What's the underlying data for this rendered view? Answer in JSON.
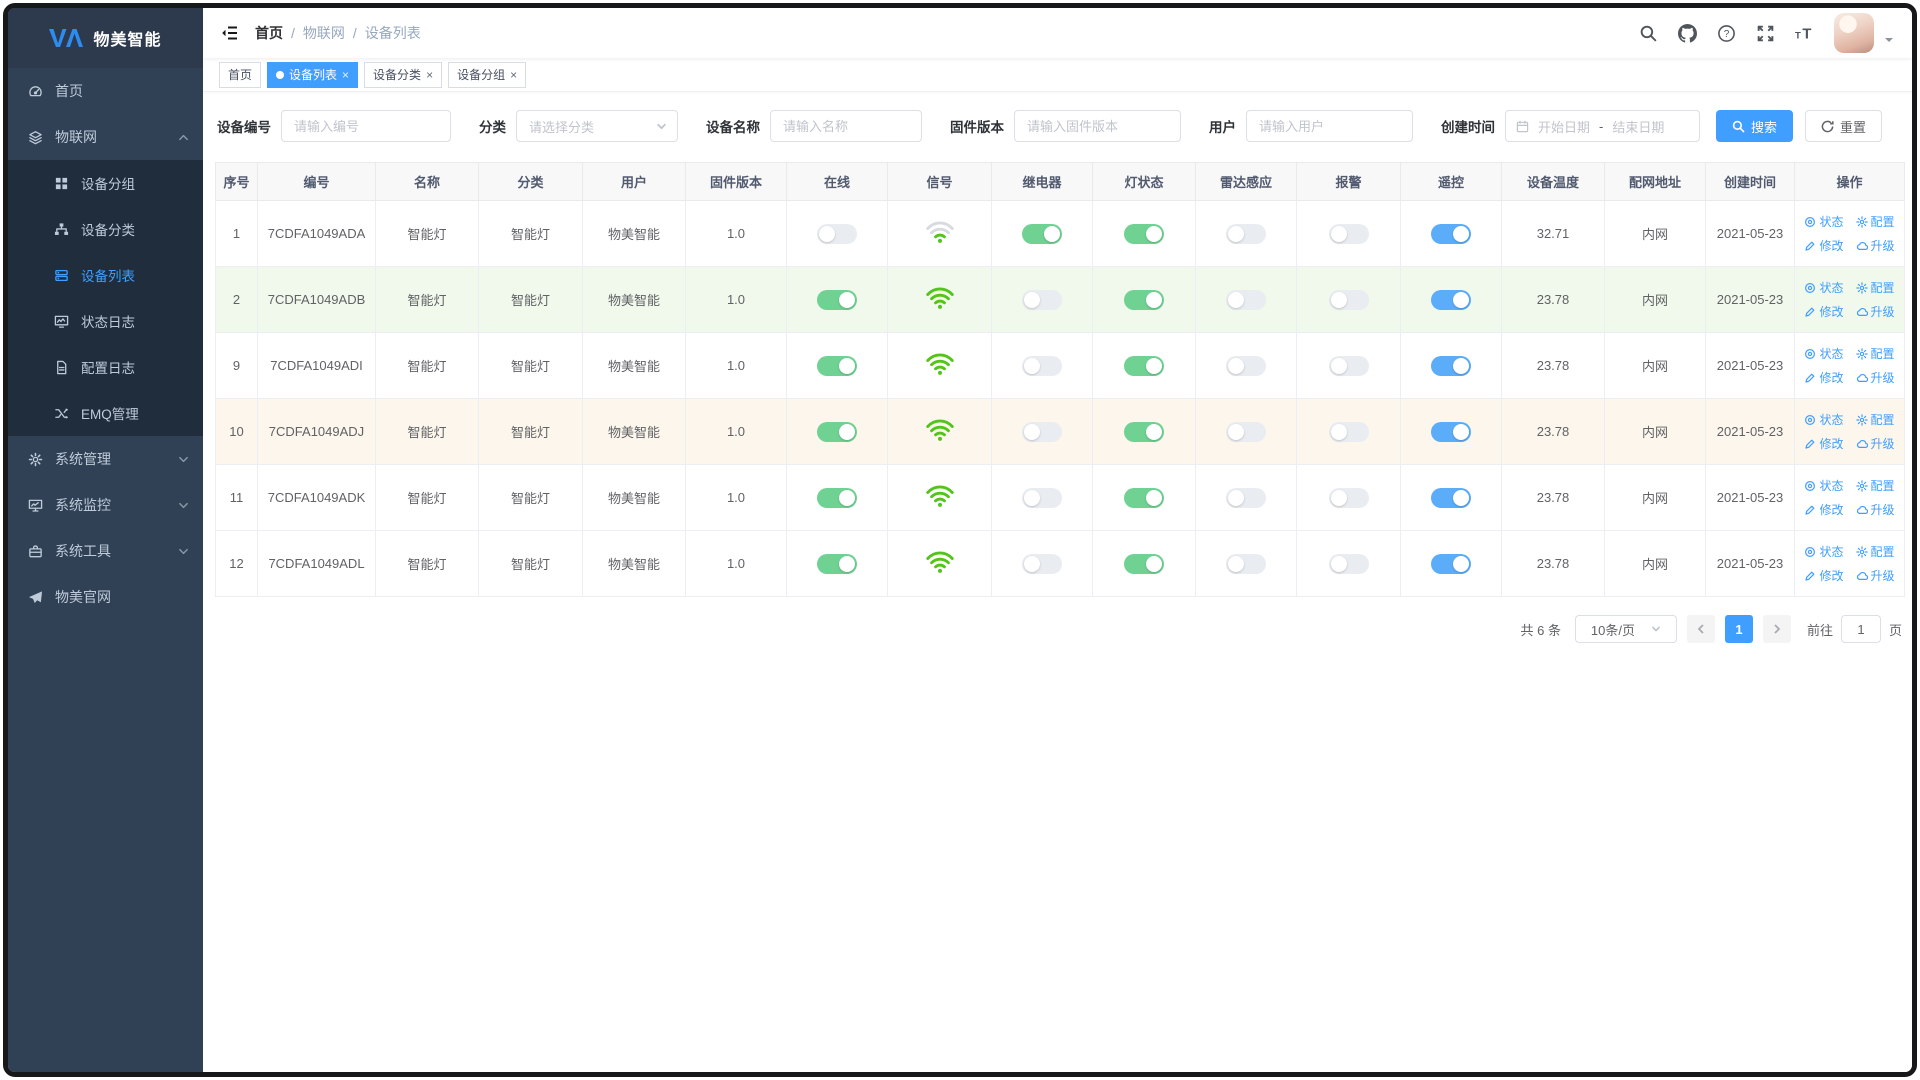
{
  "app": {
    "logo_title": "物美智能"
  },
  "sidebar": {
    "items": [
      {
        "label": "首页",
        "icon": "dashboard-icon",
        "level": 1
      },
      {
        "label": "物联网",
        "icon": "iot-icon",
        "level": 1,
        "expanded": true
      },
      {
        "label": "设备分组",
        "icon": "device-group-icon",
        "level": 2
      },
      {
        "label": "设备分类",
        "icon": "device-category-icon",
        "level": 2
      },
      {
        "label": "设备列表",
        "icon": "device-list-icon",
        "level": 2,
        "active": true
      },
      {
        "label": "状态日志",
        "icon": "status-log-icon",
        "level": 2
      },
      {
        "label": "配置日志",
        "icon": "config-log-icon",
        "level": 2
      },
      {
        "label": "EMQ管理",
        "icon": "emq-icon",
        "level": 2
      },
      {
        "label": "系统管理",
        "icon": "gear-icon",
        "level": 1,
        "collapsed": true
      },
      {
        "label": "系统监控",
        "icon": "monitor-icon",
        "level": 1,
        "collapsed": true
      },
      {
        "label": "系统工具",
        "icon": "toolbox-icon",
        "level": 1,
        "collapsed": true
      },
      {
        "label": "物美官网",
        "icon": "paper-plane-icon",
        "level": 1
      }
    ]
  },
  "navbar": {
    "breadcrumb": [
      "首页",
      "物联网",
      "设备列表"
    ]
  },
  "tabs": [
    {
      "label": "首页",
      "active": false,
      "closable": false
    },
    {
      "label": "设备列表",
      "active": true,
      "closable": true
    },
    {
      "label": "设备分类",
      "active": false,
      "closable": true
    },
    {
      "label": "设备分组",
      "active": false,
      "closable": true
    }
  ],
  "filters": {
    "device_code": {
      "label": "设备编号",
      "placeholder": "请输入编号"
    },
    "category": {
      "label": "分类",
      "placeholder": "请选择分类"
    },
    "device_name": {
      "label": "设备名称",
      "placeholder": "请输入名称"
    },
    "firmware": {
      "label": "固件版本",
      "placeholder": "请输入固件版本"
    },
    "user": {
      "label": "用户",
      "placeholder": "请输入用户"
    },
    "created": {
      "label": "创建时间",
      "start_placeholder": "开始日期",
      "separator": "-",
      "end_placeholder": "结束日期"
    },
    "search_label": "搜索",
    "reset_label": "重置"
  },
  "table": {
    "columns": [
      "序号",
      "编号",
      "名称",
      "分类",
      "用户",
      "固件版本",
      "在线",
      "信号",
      "继电器",
      "灯状态",
      "雷达感应",
      "报警",
      "遥控",
      "设备温度",
      "配网地址",
      "创建时间",
      "操作"
    ],
    "ops_labels": [
      "状态",
      "配置",
      "修改",
      "升级"
    ],
    "rows": [
      {
        "index": "1",
        "code": "7CDFA1049ADA",
        "name": "智能灯",
        "category": "智能灯",
        "user": "物美智能",
        "firmware": "1.0",
        "online": false,
        "signal": "weak",
        "relay": true,
        "light": true,
        "radar": false,
        "alarm": false,
        "remote": true,
        "temperature": "32.71",
        "network": "内网",
        "created": "2021-05-23",
        "highlight": ""
      },
      {
        "index": "2",
        "code": "7CDFA1049ADB",
        "name": "智能灯",
        "category": "智能灯",
        "user": "物美智能",
        "firmware": "1.0",
        "online": true,
        "signal": "strong",
        "relay": false,
        "light": true,
        "radar": false,
        "alarm": false,
        "remote": true,
        "temperature": "23.78",
        "network": "内网",
        "created": "2021-05-23",
        "highlight": "success"
      },
      {
        "index": "9",
        "code": "7CDFA1049ADI",
        "name": "智能灯",
        "category": "智能灯",
        "user": "物美智能",
        "firmware": "1.0",
        "online": true,
        "signal": "strong",
        "relay": false,
        "light": true,
        "radar": false,
        "alarm": false,
        "remote": true,
        "temperature": "23.78",
        "network": "内网",
        "created": "2021-05-23",
        "highlight": ""
      },
      {
        "index": "10",
        "code": "7CDFA1049ADJ",
        "name": "智能灯",
        "category": "智能灯",
        "user": "物美智能",
        "firmware": "1.0",
        "online": true,
        "signal": "strong",
        "relay": false,
        "light": true,
        "radar": false,
        "alarm": false,
        "remote": true,
        "temperature": "23.78",
        "network": "内网",
        "created": "2021-05-23",
        "highlight": "warning"
      },
      {
        "index": "11",
        "code": "7CDFA1049ADK",
        "name": "智能灯",
        "category": "智能灯",
        "user": "物美智能",
        "firmware": "1.0",
        "online": true,
        "signal": "strong",
        "relay": false,
        "light": true,
        "radar": false,
        "alarm": false,
        "remote": true,
        "temperature": "23.78",
        "network": "内网",
        "created": "2021-05-23",
        "highlight": ""
      },
      {
        "index": "12",
        "code": "7CDFA1049ADL",
        "name": "智能灯",
        "category": "智能灯",
        "user": "物美智能",
        "firmware": "1.0",
        "online": true,
        "signal": "strong",
        "relay": false,
        "light": true,
        "radar": false,
        "alarm": false,
        "remote": true,
        "temperature": "23.78",
        "network": "内网",
        "created": "2021-05-23",
        "highlight": ""
      }
    ]
  },
  "pagination": {
    "total_text": "共 6 条",
    "page_size": "10条/页",
    "current_page": "1",
    "goto_label": "前往",
    "goto_value": "1",
    "goto_suffix": "页"
  },
  "colors": {
    "primary": "#409EFF",
    "toggle_on_green": "#6fd293",
    "toggle_on_blue": "#5cadf9",
    "toggle_off": "#e9ecf1",
    "wifi_green": "#52c41a",
    "wifi_gray": "#d7dae0",
    "row_success_bg": "#f0f9eb",
    "row_warning_bg": "#fdf6ec",
    "sidebar_bg": "#304156",
    "submenu_bg": "#1f2d3d"
  }
}
